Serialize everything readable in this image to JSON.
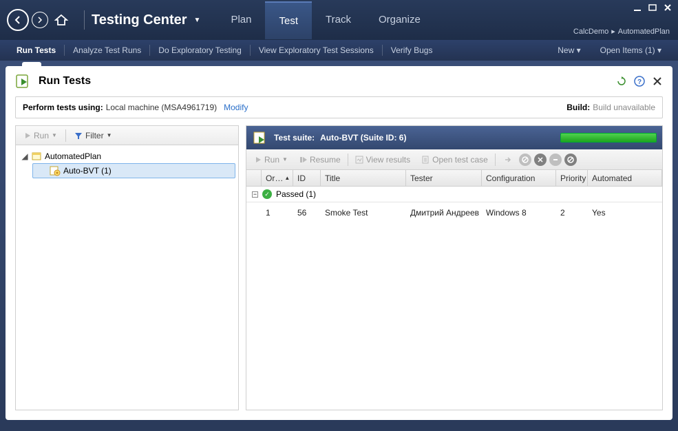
{
  "titlebar": {
    "app_title": "Testing Center",
    "tabs": {
      "plan": "Plan",
      "test": "Test",
      "track": "Track",
      "organize": "Organize"
    },
    "breadcrumb_project": "CalcDemo",
    "breadcrumb_plan": "AutomatedPlan"
  },
  "secbar": {
    "run_tests": "Run Tests",
    "analyze": "Analyze Test Runs",
    "exploratory": "Do Exploratory Testing",
    "view_exp": "View Exploratory Test Sessions",
    "verify_bugs": "Verify Bugs",
    "new": "New",
    "open_items": "Open Items (1)"
  },
  "page": {
    "title": "Run Tests",
    "perform_label": "Perform tests using:",
    "perform_value": "Local machine (MSA4961719)",
    "modify": "Modify",
    "build_label": "Build:",
    "build_value": "Build unavailable"
  },
  "left_toolbar": {
    "run": "Run",
    "filter": "Filter"
  },
  "tree": {
    "plan": "AutomatedPlan",
    "suite": "Auto-BVT (1)"
  },
  "suite_header": {
    "label": "Test suite:",
    "name": "Auto-BVT (Suite ID: 6)"
  },
  "grid_toolbar": {
    "run": "Run",
    "resume": "Resume",
    "view_results": "View results",
    "open_test_case": "Open test case"
  },
  "columns": {
    "order": "Or…",
    "id": "ID",
    "title": "Title",
    "tester": "Tester",
    "config": "Configuration",
    "priority": "Priority",
    "automated": "Automated"
  },
  "group": {
    "label": "Passed (1)"
  },
  "row": {
    "order": "1",
    "id": "56",
    "title": "Smoke Test",
    "tester": "Дмитрий Андреев",
    "config": "Windows 8",
    "priority": "2",
    "automated": "Yes"
  }
}
